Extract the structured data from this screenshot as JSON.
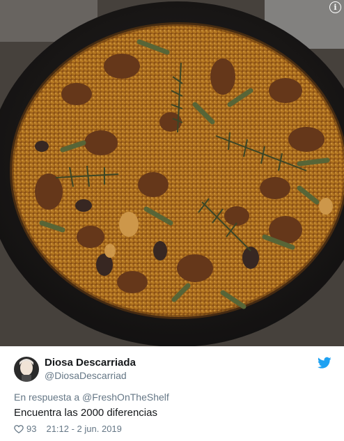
{
  "photo": {
    "alt_icon": "info-icon",
    "info_glyph": "i"
  },
  "tweet": {
    "display_name": "Diosa Descarriada",
    "handle": "@DiosaDescarriad",
    "reply_to": "En respuesta a @FreshOnTheShelf",
    "text": "Encuentra las 2000 diferencias",
    "likes": "93",
    "timestamp": "21:12 - 2 jun. 2019",
    "brand_color": "#1da1f2"
  }
}
